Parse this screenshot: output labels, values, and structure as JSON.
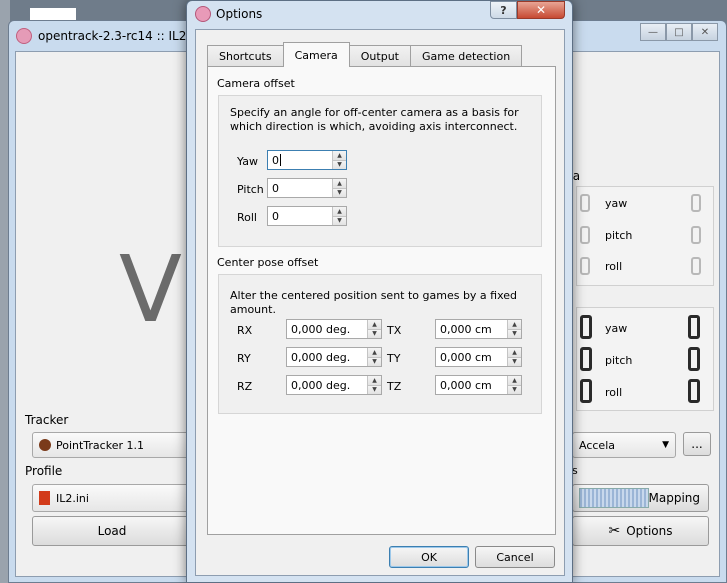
{
  "main_window": {
    "title": "opentrack-2.3-rc14 :: IL2.ini",
    "preview_letter": "V",
    "tracker": {
      "label": "Tracker",
      "selected": "PointTracker 1.1"
    },
    "profile": {
      "label": "Profile",
      "selected": "IL2.ini",
      "load_button": "Load"
    },
    "raw_data_label": "ta",
    "raw_axes": [
      "yaw",
      "pitch",
      "roll"
    ],
    "game_axes": [
      "yaw",
      "pitch",
      "roll"
    ],
    "filter": {
      "selected": "Accela",
      "more_button": "..."
    },
    "options_label": "s",
    "mapping_button": "Mapping",
    "options_button": "Options"
  },
  "dialog": {
    "title": "Options",
    "help_button": "?",
    "close_button": "✕",
    "tabs": [
      {
        "label": "Shortcuts",
        "active": false
      },
      {
        "label": "Camera",
        "active": true
      },
      {
        "label": "Output",
        "active": false
      },
      {
        "label": "Game detection",
        "active": false
      }
    ],
    "camera_offset": {
      "title": "Camera offset",
      "description": "Specify an angle for off-center camera as a basis for which direction is which, avoiding axis interconnect.",
      "fields": [
        {
          "label": "Yaw",
          "value": "0"
        },
        {
          "label": "Pitch",
          "value": "0"
        },
        {
          "label": "Roll",
          "value": "0"
        }
      ]
    },
    "center_pose": {
      "title": "Center pose offset",
      "description": "Alter the centered position sent to games by a fixed amount.",
      "rotation": [
        {
          "label": "RX",
          "value": "0,000 deg."
        },
        {
          "label": "RY",
          "value": "0,000 deg."
        },
        {
          "label": "RZ",
          "value": "0,000 deg."
        }
      ],
      "translation": [
        {
          "label": "TX",
          "value": "0,000 cm"
        },
        {
          "label": "TY",
          "value": "0,000 cm"
        },
        {
          "label": "TZ",
          "value": "0,000 cm"
        }
      ]
    },
    "ok_button": "OK",
    "cancel_button": "Cancel"
  }
}
